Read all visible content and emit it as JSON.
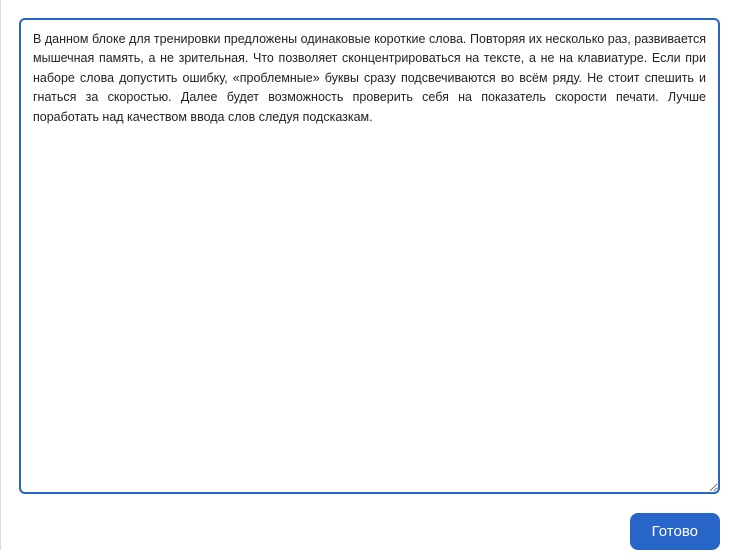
{
  "textarea": {
    "value": "В данном блоке для тренировки предложены одинаковые короткие слова. Повторяя их несколько раз, развивается мышечная память, а не зрительная. Что позволяет сконцентрироваться на тексте, а не на клавиатуре. Если при наборе слова допустить ошибку, «проблемные» буквы сразу подсвечиваются во всём ряду. Не стоит спешить и гнаться за скоростью. Далее будет возможность проверить себя на показатель скорости печати. Лучше поработать над качеством ввода слов следуя подсказкам. "
  },
  "buttons": {
    "ready_label": "Готово"
  }
}
